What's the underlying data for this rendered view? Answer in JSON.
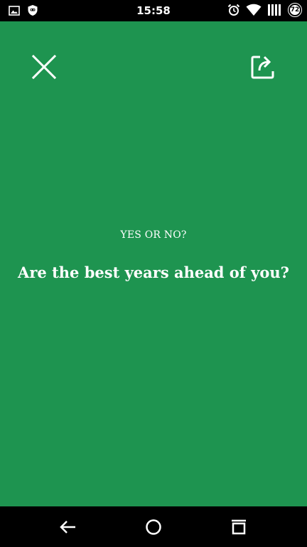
{
  "status_bar": {
    "time": "15:58",
    "battery_level": "72",
    "left_icons": [
      "image-icon",
      "shield-icon"
    ],
    "right_icons": [
      "alarm-icon",
      "wifi-icon",
      "signal-icon",
      "battery-icon"
    ]
  },
  "card": {
    "label": "YES OR NO?",
    "question": "Are the best years ahead of you?",
    "background_color": "#1e9450",
    "close_icon": "close-icon",
    "share_icon": "share-icon"
  },
  "nav_bar": {
    "buttons": [
      "back-icon",
      "home-icon",
      "recents-icon"
    ]
  }
}
